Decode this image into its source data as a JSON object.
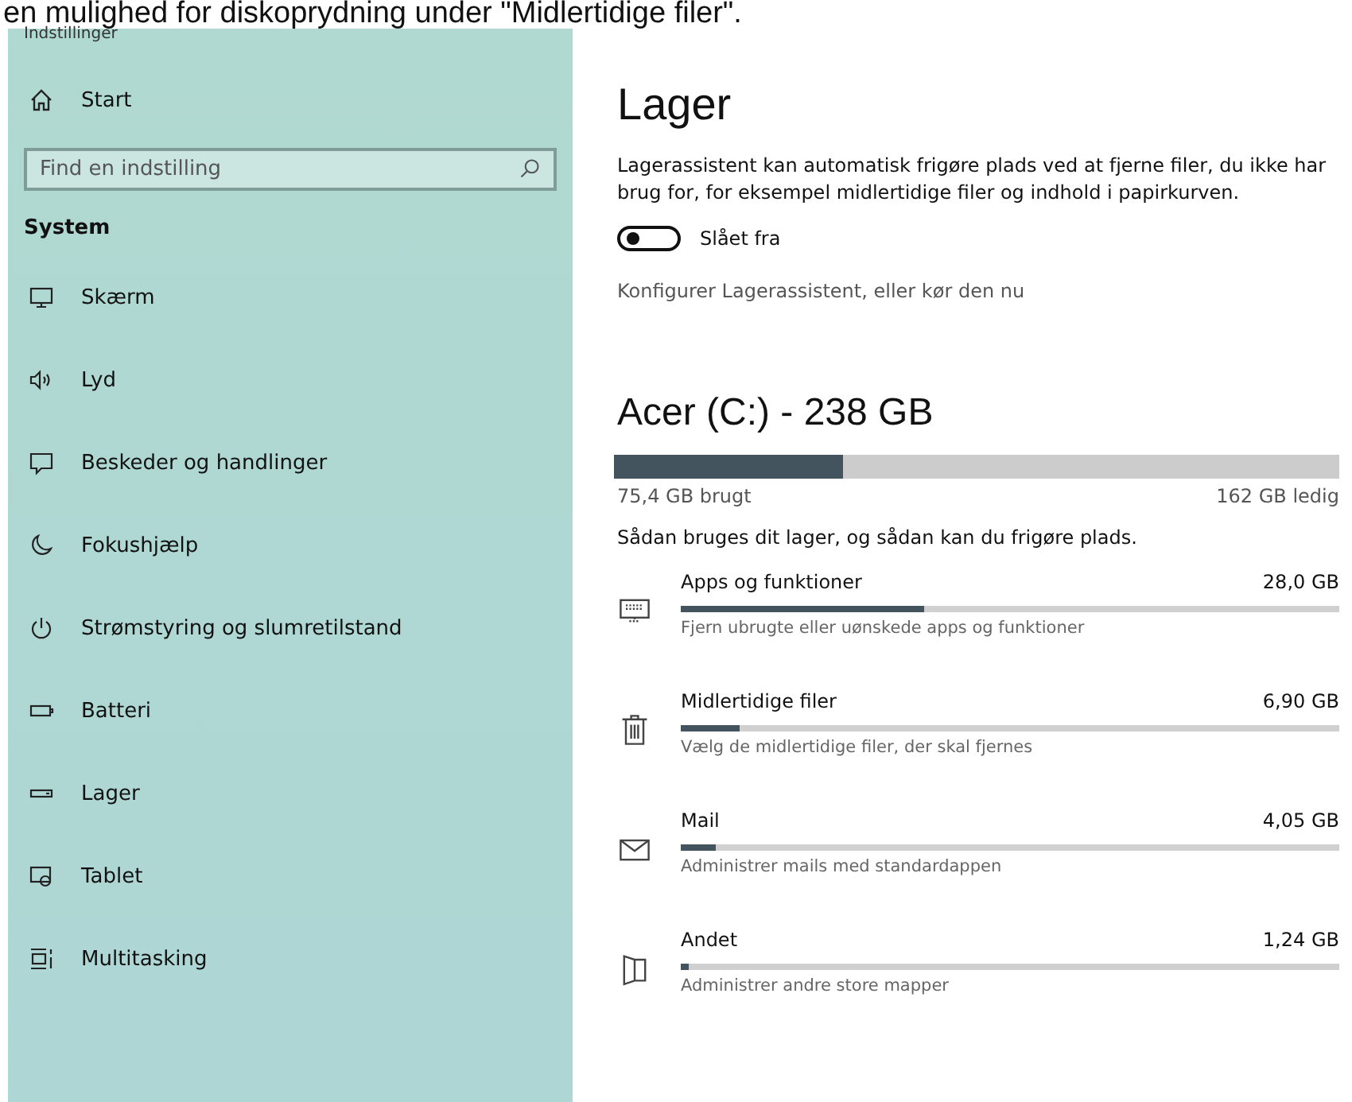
{
  "caption": "en mulighed for diskoprydning under \"Midlertidige filer\".",
  "window": {
    "title": "Indstillinger"
  },
  "sidebar": {
    "home": "Start",
    "search": {
      "placeholder": "Find en indstilling"
    },
    "section": "System",
    "items": [
      {
        "label": "Skærm",
        "kind": "monitor"
      },
      {
        "label": "Lyd",
        "kind": "speaker"
      },
      {
        "label": "Beskeder og handlinger",
        "kind": "message"
      },
      {
        "label": "Fokushjælp",
        "kind": "moon"
      },
      {
        "label": "Strømstyring og slumretilstand",
        "kind": "power"
      },
      {
        "label": "Batteri",
        "kind": "battery"
      },
      {
        "label": "Lager",
        "kind": "drive"
      },
      {
        "label": "Tablet",
        "kind": "tablet"
      },
      {
        "label": "Multitasking",
        "kind": "multitask"
      }
    ]
  },
  "content": {
    "title": "Lager",
    "description": "Lagerassistent kan automatisk frigøre plads ved at fjerne filer, du ikke har brug for, for eksempel midlertidige filer og indhold i papirkurven.",
    "toggle": {
      "on": false,
      "label": "Slået fra"
    },
    "link": "Konfigurer Lagerassistent, eller kør den nu",
    "drive": {
      "title": "Acer (C:) - 238 GB",
      "level": 0.315,
      "used": "75,4 GB brugt",
      "free": "162 GB ledig"
    },
    "usage_intro": "Sådan bruges dit lager, og sådan kan du frigøre plads.",
    "categories": [
      {
        "kind": "keyboard",
        "name": "Apps og funktioner",
        "size": "28,0 GB",
        "level": 0.37,
        "hint": "Fjern ubrugte eller uønskede apps og funktioner"
      },
      {
        "kind": "trash",
        "name": "Midlertidige filer",
        "size": "6,90 GB",
        "level": 0.09,
        "hint": "Vælg de midlertidige filer, der skal fjernes"
      },
      {
        "kind": "mail",
        "name": "Mail",
        "size": "4,05 GB",
        "level": 0.053,
        "hint": "Administrer mails med standardappen"
      },
      {
        "kind": "folder",
        "name": "Andet",
        "size": "1,24 GB",
        "level": 0.012,
        "hint": "Administrer andre store mapper"
      }
    ]
  }
}
